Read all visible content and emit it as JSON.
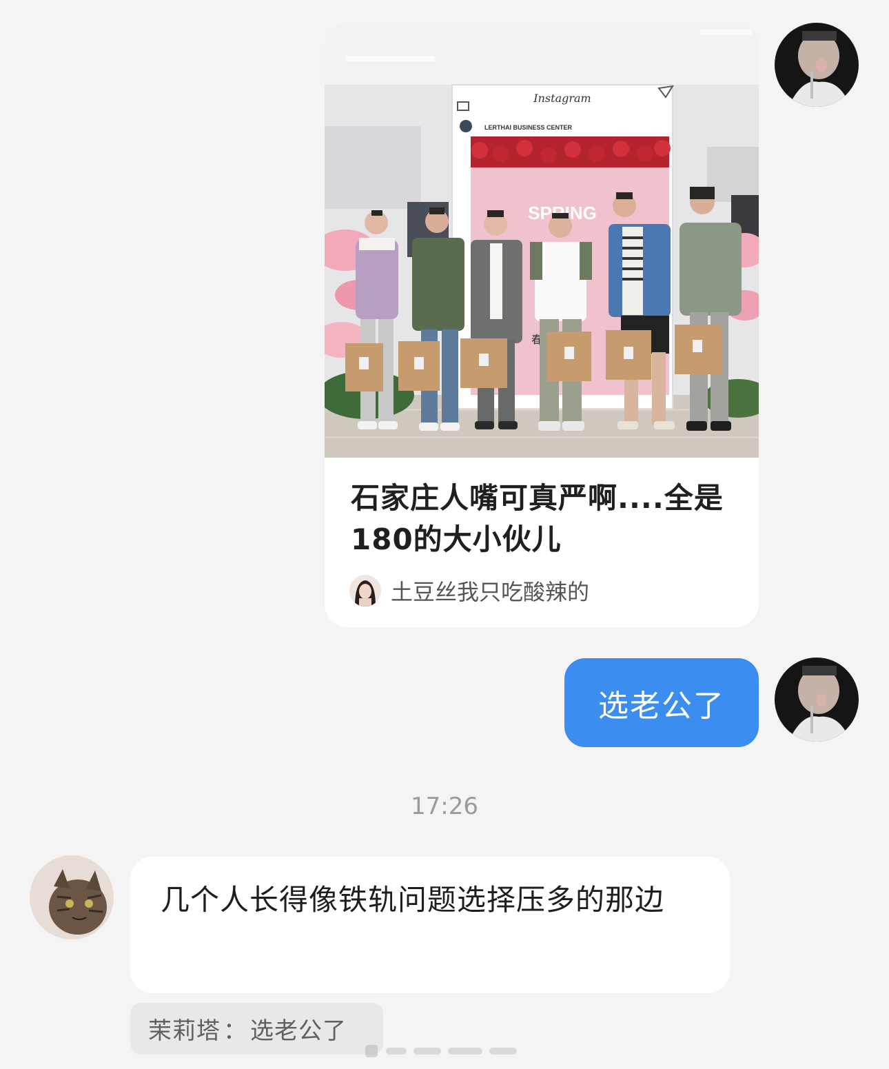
{
  "shared_post": {
    "title": "石家庄人嘴可真严啊....全是180的大小伙儿",
    "author": "土豆丝我只吃酸辣的",
    "photo": {
      "frame_brand": "Instagram",
      "frame_sign": "LERTHAI BUSINESS CENTER",
      "backdrop_text": "SPRING",
      "backdrop_char": "春"
    }
  },
  "my_message": {
    "text": "选老公了"
  },
  "timestamp": "17:26",
  "other_message": {
    "text": "几个人长得像铁轨问题选择压多的那边",
    "quote_author": "茉莉塔",
    "quote_separator": "：",
    "quote_text": "选老公了"
  },
  "colors": {
    "background": "#f4f4f4",
    "my_bubble": "#3b8ef0",
    "other_bubble": "#ffffff",
    "quote_bg": "#e8e8e8",
    "timestamp": "#9a9a9a"
  },
  "icons": {
    "my_avatar": "avatar-man-icon",
    "other_avatar": "avatar-cat-icon",
    "author_avatar": "avatar-woman-icon"
  }
}
